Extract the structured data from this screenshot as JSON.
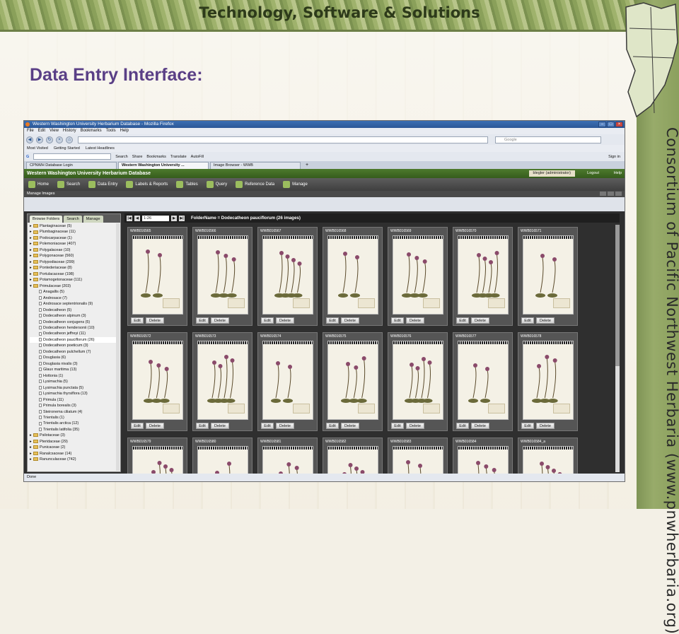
{
  "slide": {
    "title": "Technology, Software & Solutions",
    "subtitle": "Data Entry Interface:",
    "side_text": "Consortium of Pacific Northwest Herbaria (www.pnwherbaria.org)"
  },
  "browser": {
    "window_title": "Western Washington University Herbarium Database - Mozilla Firefox",
    "menu": [
      "File",
      "Edit",
      "View",
      "History",
      "Bookmarks",
      "Tools",
      "Help"
    ],
    "search_placeholder": "Google",
    "bookmarks": [
      "Most Visited",
      "Getting Started",
      "Latest Headlines"
    ],
    "google_toolbar": [
      "Search",
      "Share",
      "Bookmarks",
      "Translate",
      "AutoFill",
      "Sign in"
    ],
    "tabs": [
      "CPNWH Database Login",
      "Western Washington University ...",
      "Image Browser - WWB"
    ],
    "status": "Done"
  },
  "app": {
    "header": "Western Washington University Herbarium Database",
    "user": "blegler (administrator)",
    "logout": "Logout",
    "help": "Help",
    "nav": [
      "Home",
      "Search",
      "Data Entry",
      "Labels & Reports",
      "Tables",
      "Query",
      "Reference Data",
      "Manage"
    ],
    "panel_title": "Manage Images",
    "left_tabs": [
      "Browse Folders",
      "Search",
      "Manage"
    ],
    "page_select": "1-26",
    "folder_label": "FolderName = Dodecatheon pauciflorum (26 images)"
  },
  "tree": [
    {
      "label": "Plantaginaceae (5)",
      "kind": "family"
    },
    {
      "label": "Plumbaginaceae (11)",
      "kind": "family"
    },
    {
      "label": "Podocarpaceae (1)",
      "kind": "family"
    },
    {
      "label": "Polemoniaceae (407)",
      "kind": "family"
    },
    {
      "label": "Polygalaceae (10)",
      "kind": "family"
    },
    {
      "label": "Polygonaceae (560)",
      "kind": "family"
    },
    {
      "label": "Polypodiaceae (299)",
      "kind": "family"
    },
    {
      "label": "Pontederiaceae (8)",
      "kind": "family"
    },
    {
      "label": "Portulacaceae (198)",
      "kind": "family"
    },
    {
      "label": "Potamogetonaceae (111)",
      "kind": "family"
    },
    {
      "label": "Primulaceae (203)",
      "kind": "family-open"
    },
    {
      "label": "Anagallis (5)",
      "kind": "leaf"
    },
    {
      "label": "Androsace (7)",
      "kind": "leaf"
    },
    {
      "label": "Androsace septentrionalis (9)",
      "kind": "leaf"
    },
    {
      "label": "Dodecatheon (5)",
      "kind": "leaf"
    },
    {
      "label": "Dodecatheon alpinum (3)",
      "kind": "leaf"
    },
    {
      "label": "Dodecatheon conjugens (5)",
      "kind": "leaf"
    },
    {
      "label": "Dodecatheon hendersonii (10)",
      "kind": "leaf"
    },
    {
      "label": "Dodecatheon jeffreyi (11)",
      "kind": "leaf"
    },
    {
      "label": "Dodecatheon pauciflorum (26)",
      "kind": "leaf-selected"
    },
    {
      "label": "Dodecatheon poeticum (3)",
      "kind": "leaf"
    },
    {
      "label": "Dodecatheon pulchellum (7)",
      "kind": "leaf"
    },
    {
      "label": "Douglasia (6)",
      "kind": "leaf"
    },
    {
      "label": "Douglasia nivalis (3)",
      "kind": "leaf"
    },
    {
      "label": "Glaux maritima (13)",
      "kind": "leaf"
    },
    {
      "label": "Hottonia (1)",
      "kind": "leaf"
    },
    {
      "label": "Lysimachia (5)",
      "kind": "leaf"
    },
    {
      "label": "Lysimachia punctata (5)",
      "kind": "leaf"
    },
    {
      "label": "Lysimachia thyrsiflora (13)",
      "kind": "leaf"
    },
    {
      "label": "Primula (11)",
      "kind": "leaf"
    },
    {
      "label": "Primula borealis (3)",
      "kind": "leaf"
    },
    {
      "label": "Steironema ciliatum (4)",
      "kind": "leaf"
    },
    {
      "label": "Trientalis (1)",
      "kind": "leaf"
    },
    {
      "label": "Trientalis arctica (12)",
      "kind": "leaf"
    },
    {
      "label": "Trientalis latifolia (35)",
      "kind": "leaf"
    },
    {
      "label": "Psilotaceae (3)",
      "kind": "family"
    },
    {
      "label": "Pteridaceae (29)",
      "kind": "family"
    },
    {
      "label": "Punicaceae (2)",
      "kind": "family"
    },
    {
      "label": "Ranalcsaceae (14)",
      "kind": "family"
    },
    {
      "label": "Ranunculaceae (742)",
      "kind": "family"
    }
  ],
  "images": [
    "WWB016565",
    "WWB016566",
    "WWB016567",
    "WWB016568",
    "WWB016569",
    "WWB016570",
    "WWB016571",
    "WWB016572",
    "WWB016573",
    "WWB016574",
    "WWB016575",
    "WWB016576",
    "WWB016577",
    "WWB016578",
    "WWB016579",
    "WWB016580",
    "WWB016581",
    "WWB016582",
    "WWB016583",
    "WWB016584",
    "WWB016584_a"
  ],
  "card_buttons": {
    "edit": "Edit",
    "delete": "Delete"
  }
}
